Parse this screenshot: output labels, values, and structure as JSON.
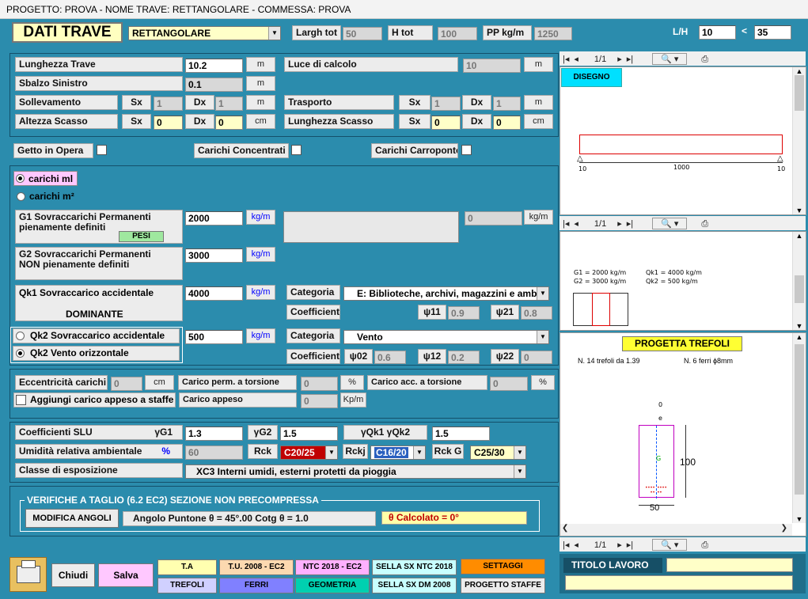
{
  "window": {
    "title": "PROGETTO: PROVA - NOME TRAVE: RETTANGOLARE - COMMESSA: PROVA"
  },
  "header": {
    "title": "DATI TRAVE",
    "type_value": "RETTANGOLARE",
    "largh_label": "Largh tot",
    "largh_value": "50",
    "h_label": "H tot",
    "h_value": "100",
    "pp_label": "PP kg/m",
    "pp_value": "1250",
    "lh_label": "L/H",
    "lh_value": "10",
    "lt": "<",
    "lh_max": "35"
  },
  "geom": {
    "lunghezza_label": "Lunghezza Trave",
    "lunghezza_value": "10.2",
    "m": "m",
    "luce_label": "Luce di calcolo",
    "luce_value": "10",
    "sbalzo_label": "Sbalzo Sinistro",
    "sbalzo_value": "0.1",
    "soll_label": "Sollevamento",
    "sx": "Sx",
    "dx": "Dx",
    "soll_sx": "1",
    "soll_dx": "1",
    "trasp_label": "Trasporto",
    "trasp_sx": "1",
    "trasp_dx": "1",
    "scasso_label": "Altezza Scasso",
    "scasso_sx": "0",
    "scasso_dx": "0",
    "cm": "cm",
    "lscasso_label": "Lunghezza Scasso",
    "lscasso_sx": "0",
    "lscasso_dx": "0"
  },
  "checks": {
    "getto": "Getto in Opera",
    "conc": "Carichi Concentrati",
    "carr": "Carichi Carroponte"
  },
  "loads": {
    "ml": "carichi ml",
    "m2": "carichi m²",
    "g1_label": "G1   Sovraccarichi Permanenti\n       pienamente definiti",
    "g1_value": "2000",
    "kgm": "kg/m",
    "pesi": "PESI",
    "side_value": "0",
    "g2_label": "G2   Sovraccarichi Permanenti\n       NON pienamente definiti",
    "g2_value": "3000",
    "qk1_label": "Qk1  Sovraccarico accidentale",
    "qk1_dom": "DOMINANTE",
    "qk1_value": "4000",
    "categoria": "Categoria",
    "coefficienti": "Coefficienti",
    "cat1_value": "E: Biblioteche, archivi, magazzini e amb",
    "psi11": "ψ11",
    "psi11_v": "0.9",
    "psi21": "ψ21",
    "psi21_v": "0.8",
    "qk2a": "Qk2  Sovraccarico accidentale",
    "qk2b": "Qk2  Vento orizzontale",
    "qk2_value": "500",
    "cat2_value": "Vento",
    "psi02": "ψ02",
    "psi02_v": "0.6",
    "psi12": "ψ12",
    "psi12_v": "0.2",
    "psi22": "ψ22",
    "psi22_v": "0"
  },
  "ecc": {
    "ecc_label": "Eccentricità carichi",
    "ecc_value": "0",
    "cm": "cm",
    "tors_label": "Carico perm. a torsione",
    "tors_value": "0",
    "pct": "%",
    "acc_label": "Carico acc. a torsione",
    "acc_value": "0",
    "staffe_label": "Aggiungi carico appeso a staffe",
    "appeso_label": "Carico appeso",
    "appeso_value": "0",
    "kpm": "Kp/m"
  },
  "slu": {
    "coef_label": "Coefficienti SLU",
    "g1": "γG1",
    "g1_v": "1.3",
    "g2": "γG2",
    "g2_v": "1.5",
    "gq": "γQk1  γQk2",
    "gq_v": "1.5",
    "umid_label": "Umidità relativa ambientale",
    "umid_pct": "%",
    "umid_v": "60",
    "rck": "Rck",
    "rck_v": "C20/25",
    "rckj": "Rckj",
    "rckj_v": "C16/20",
    "rckg": "Rck G",
    "rckg_v": "C25/30",
    "classe_label": "Classe di esposizione",
    "classe_v": "XC3   Interni umidi, esterni protetti da pioggia"
  },
  "taglio": {
    "title": "VERIFICHE A TAGLIO (6.2 EC2) SEZIONE NON PRECOMPRESSA",
    "btn": "MODIFICA ANGOLI",
    "angolo": "Angolo Puntone  θ  =  45°.00        Cotg θ  = 1.0",
    "calc": "θ   Calcolato =  0°"
  },
  "right": {
    "page": "1/1",
    "disegno": "DISEGNO",
    "dim_l": "10",
    "dim_mid": "1000",
    "dim_r": "10",
    "g1_txt": "G1 = 2000 kg/m",
    "g2_txt": "G2 = 3000 kg/m",
    "qk1_txt": "Qk1 = 4000 kg/m",
    "qk2_txt": "Qk2 = 500 kg/m",
    "progetta": "PROGETTA TREFOLI",
    "trefoli_txt": "N. 14 trefoli da 1.39",
    "ferri_txt": "N. 6 ferri  ϕ8mm",
    "sec_h": "100",
    "sec_b": "50",
    "sec_e": "e",
    "sec_0": "0",
    "sec_g": "G"
  },
  "footer": {
    "chiudi": "Chiudi",
    "salva": "Salva",
    "ta": "T.A",
    "tu": "T.U. 2008 - EC2",
    "ntc": "NTC 2018 - EC2",
    "sella_ntc": "SELLA SX NTC 2018",
    "settaggi": "SETTAGGI",
    "trefoli": "TREFOLI",
    "ferri": "FERRI",
    "geometria": "GEOMETRIA",
    "sella_dm": "SELLA SX DM 2008",
    "staffe": "PROGETTO STAFFE",
    "titolo": "TITOLO LAVORO"
  },
  "colors": {
    "main_bg": "#2b8cad",
    "accent_yellow": "#ffff33",
    "disegno": "#00e0ff"
  }
}
